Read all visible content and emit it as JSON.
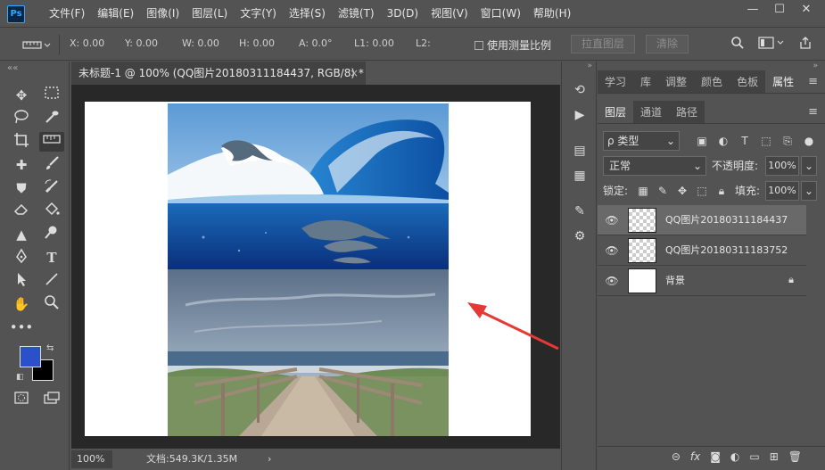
{
  "app": {
    "logo": "Ps"
  },
  "menu": [
    "文件(F)",
    "编辑(E)",
    "图像(I)",
    "图层(L)",
    "文字(Y)",
    "选择(S)",
    "滤镜(T)",
    "3D(D)",
    "视图(V)",
    "窗口(W)",
    "帮助(H)"
  ],
  "window_controls": {
    "minimize": "—",
    "maximize": "☐",
    "close": "✕"
  },
  "options": {
    "x": "X: 0.00",
    "y": "Y: 0.00",
    "w": "W: 0.00",
    "h": "H: 0.00",
    "a": "A: 0.0°",
    "l1": "L1: 0.00",
    "l2": "L2:",
    "use_scale": "使用测量比例",
    "straighten": "拉直图层",
    "clear": "清除"
  },
  "document": {
    "tab_title": "未标题-1 @ 100% (QQ图片20180311184437, RGB/8) *",
    "close": "×",
    "zoom": "100%",
    "info": "文档:549.3K/1.35M",
    "arrow": "›"
  },
  "colors": {
    "foreground": "#2b51c8",
    "background": "#000000",
    "annotation_arrow": "#e53935"
  },
  "panels": {
    "top_tabs": [
      "学习",
      "库",
      "调整",
      "颜色",
      "色板",
      "属性"
    ],
    "layer_tabs": [
      "图层",
      "通道",
      "路径"
    ],
    "filter_label": "ρ 类型",
    "blend_mode": "正常",
    "opacity_label": "不透明度:",
    "opacity_value": "100%",
    "lock_label": "锁定:",
    "fill_label": "填充:",
    "fill_value": "100%"
  },
  "layers": [
    {
      "name": "QQ图片20180311184437",
      "selected": true
    },
    {
      "name": "QQ图片20180311183752",
      "selected": false
    },
    {
      "name": "背景",
      "selected": false,
      "locked": true
    }
  ]
}
